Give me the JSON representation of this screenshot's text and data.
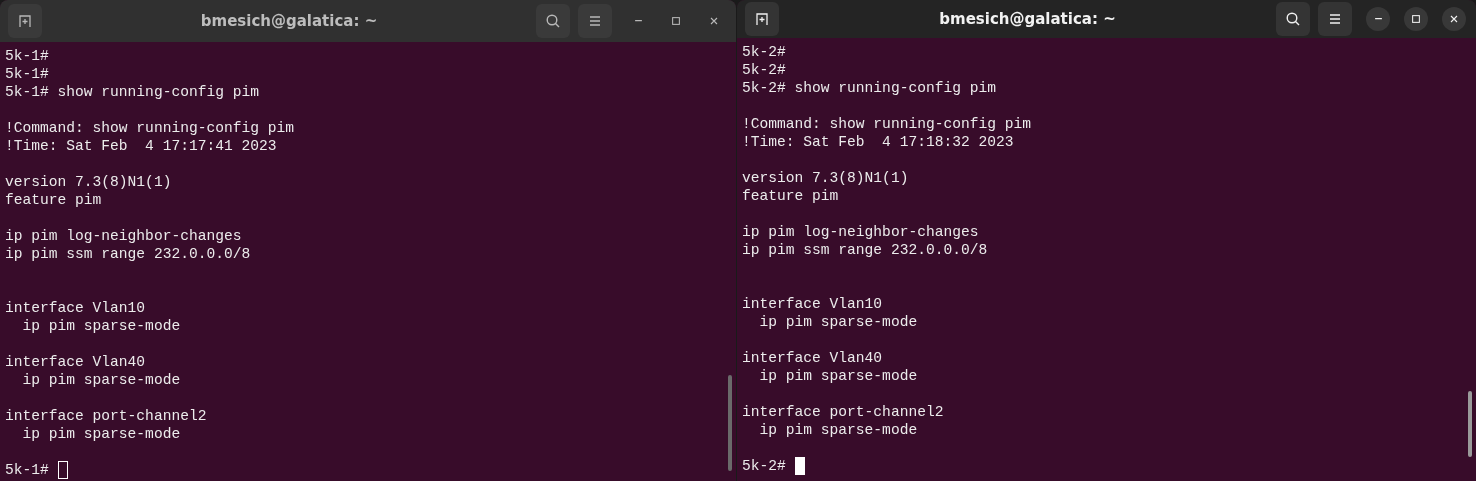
{
  "windows": [
    {
      "title": "bmesich@galatica: ~",
      "focused": false,
      "lines": [
        {
          "kind": "text",
          "text": "5k-1#"
        },
        {
          "kind": "text",
          "text": "5k-1#"
        },
        {
          "kind": "text",
          "text": "5k-1# show running-config pim"
        },
        {
          "kind": "blank"
        },
        {
          "kind": "text",
          "text": "!Command: show running-config pim"
        },
        {
          "kind": "text",
          "text": "!Time: Sat Feb  4 17:17:41 2023"
        },
        {
          "kind": "blank"
        },
        {
          "kind": "text",
          "text": "version 7.3(8)N1(1)"
        },
        {
          "kind": "text",
          "text": "feature pim"
        },
        {
          "kind": "blank"
        },
        {
          "kind": "text",
          "text": "ip pim log-neighbor-changes"
        },
        {
          "kind": "text",
          "text": "ip pim ssm range 232.0.0.0/8"
        },
        {
          "kind": "blank"
        },
        {
          "kind": "blank"
        },
        {
          "kind": "text",
          "text": "interface Vlan10"
        },
        {
          "kind": "text",
          "text": "  ip pim sparse-mode"
        },
        {
          "kind": "blank"
        },
        {
          "kind": "text",
          "text": "interface Vlan40"
        },
        {
          "kind": "text",
          "text": "  ip pim sparse-mode"
        },
        {
          "kind": "blank"
        },
        {
          "kind": "text",
          "text": "interface port-channel2"
        },
        {
          "kind": "text",
          "text": "  ip pim sparse-mode"
        },
        {
          "kind": "blank"
        }
      ],
      "prompt": "5k-1#"
    },
    {
      "title": "bmesich@galatica: ~",
      "focused": true,
      "lines": [
        {
          "kind": "text",
          "text": "5k-2#"
        },
        {
          "kind": "text",
          "text": "5k-2#"
        },
        {
          "kind": "text",
          "text": "5k-2# show running-config pim"
        },
        {
          "kind": "blank"
        },
        {
          "kind": "text",
          "text": "!Command: show running-config pim"
        },
        {
          "kind": "text",
          "text": "!Time: Sat Feb  4 17:18:32 2023"
        },
        {
          "kind": "blank"
        },
        {
          "kind": "text",
          "text": "version 7.3(8)N1(1)"
        },
        {
          "kind": "text",
          "text": "feature pim"
        },
        {
          "kind": "blank"
        },
        {
          "kind": "text",
          "text": "ip pim log-neighbor-changes"
        },
        {
          "kind": "text",
          "text": "ip pim ssm range 232.0.0.0/8"
        },
        {
          "kind": "blank"
        },
        {
          "kind": "blank"
        },
        {
          "kind": "text",
          "text": "interface Vlan10"
        },
        {
          "kind": "text",
          "text": "  ip pim sparse-mode"
        },
        {
          "kind": "blank"
        },
        {
          "kind": "text",
          "text": "interface Vlan40"
        },
        {
          "kind": "text",
          "text": "  ip pim sparse-mode"
        },
        {
          "kind": "blank"
        },
        {
          "kind": "text",
          "text": "interface port-channel2"
        },
        {
          "kind": "text",
          "text": "  ip pim sparse-mode"
        },
        {
          "kind": "blank"
        }
      ],
      "prompt": "5k-2#"
    }
  ]
}
